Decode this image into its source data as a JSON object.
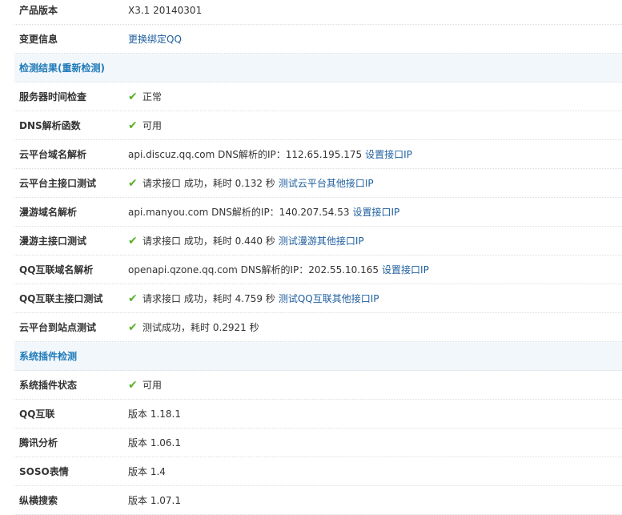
{
  "rows": [
    {
      "type": "row",
      "label": "产品版本",
      "text": "X3.1 20140301"
    },
    {
      "type": "row",
      "label": "变更信息",
      "link": "更换绑定QQ"
    },
    {
      "type": "header",
      "label": "检测结果(重新检测)"
    },
    {
      "type": "row",
      "label": "服务器时间检查",
      "check": true,
      "text": "正常"
    },
    {
      "type": "row",
      "label": "DNS解析函数",
      "check": true,
      "text": "可用"
    },
    {
      "type": "row",
      "label": "云平台域名解析",
      "text": "api.discuz.qq.com DNS解析的IP：112.65.195.175",
      "link": "设置接口IP"
    },
    {
      "type": "row",
      "label": "云平台主接口测试",
      "check": true,
      "text": "请求接口 成功，耗时 0.132 秒",
      "link": "测试云平台其他接口IP"
    },
    {
      "type": "row",
      "label": "漫游域名解析",
      "text": "api.manyou.com DNS解析的IP：140.207.54.53",
      "link": "设置接口IP"
    },
    {
      "type": "row",
      "label": "漫游主接口测试",
      "check": true,
      "text": "请求接口 成功，耗时 0.440 秒",
      "link": "测试漫游其他接口IP"
    },
    {
      "type": "row",
      "label": "QQ互联域名解析",
      "text": "openapi.qzone.qq.com DNS解析的IP：202.55.10.165",
      "link": "设置接口IP"
    },
    {
      "type": "row",
      "label": "QQ互联主接口测试",
      "check": true,
      "text": "请求接口 成功，耗时 4.759 秒",
      "link": "测试QQ互联其他接口IP"
    },
    {
      "type": "row",
      "label": "云平台到站点测试",
      "check": true,
      "text": "测试成功，耗时 0.2921 秒"
    },
    {
      "type": "header",
      "label": "系统插件检测"
    },
    {
      "type": "row",
      "label": "系统插件状态",
      "check": true,
      "text": "可用"
    },
    {
      "type": "row",
      "label": "QQ互联",
      "text": "版本 1.18.1"
    },
    {
      "type": "row",
      "label": "腾讯分析",
      "text": "版本 1.06.1"
    },
    {
      "type": "row",
      "label": "SOSO表情",
      "text": "版本 1.4"
    },
    {
      "type": "row",
      "label": "纵横搜索",
      "text": "版本 1.07.1"
    }
  ],
  "colors": {
    "accent": "#1f7ab8",
    "link": "#1f5f9e",
    "check": "#5bb02b",
    "header_bg": "#f2f7fc"
  }
}
